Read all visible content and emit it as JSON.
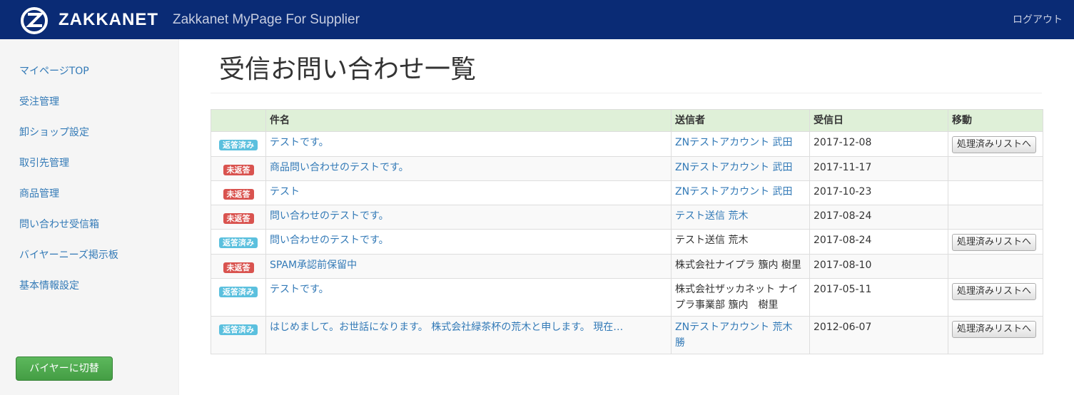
{
  "header": {
    "brand": "ZAKKANET",
    "subtitle": "Zakkanet MyPage For Supplier",
    "logout": "ログアウト"
  },
  "sidebar": {
    "items": [
      {
        "label": "マイページTOP"
      },
      {
        "label": "受注管理"
      },
      {
        "label": "卸ショップ設定"
      },
      {
        "label": "取引先管理"
      },
      {
        "label": "商品管理"
      },
      {
        "label": "問い合わせ受信箱"
      },
      {
        "label": "バイヤーニーズ掲示板"
      },
      {
        "label": "基本情報設定"
      }
    ],
    "switch_button": "バイヤーに切替"
  },
  "main": {
    "title": "受信お問い合わせ一覧",
    "table": {
      "columns": [
        "",
        "件名",
        "送信者",
        "受信日",
        "移動"
      ],
      "rows": [
        {
          "status": "返答済み",
          "status_type": "replied",
          "subject": "テストです。",
          "sender": "ZNテストアカウント 武田",
          "sender_link": true,
          "date": "2017-12-08",
          "action": "処理済みリストへ"
        },
        {
          "status": "未返答",
          "status_type": "unreplied",
          "subject": "商品問い合わせのテストです。",
          "sender": "ZNテストアカウント 武田",
          "sender_link": true,
          "date": "2017-11-17",
          "action": ""
        },
        {
          "status": "未返答",
          "status_type": "unreplied",
          "subject": "テスト",
          "sender": "ZNテストアカウント 武田",
          "sender_link": true,
          "date": "2017-10-23",
          "action": ""
        },
        {
          "status": "未返答",
          "status_type": "unreplied",
          "subject": "問い合わせのテストです。",
          "sender": "テスト送信 荒木",
          "sender_link": true,
          "date": "2017-08-24",
          "action": ""
        },
        {
          "status": "返答済み",
          "status_type": "replied",
          "subject": "問い合わせのテストです。",
          "sender": "テスト送信 荒木",
          "sender_link": false,
          "date": "2017-08-24",
          "action": "処理済みリストへ"
        },
        {
          "status": "未返答",
          "status_type": "unreplied",
          "subject": "SPAM承認前保留中",
          "sender": "株式会社ナイプラ 籏内 樹里",
          "sender_link": false,
          "date": "2017-08-10",
          "action": ""
        },
        {
          "status": "返答済み",
          "status_type": "replied",
          "subject": "テストです。",
          "sender": "株式会社ザッカネット ナイプラ事業部 籏内　樹里",
          "sender_link": false,
          "date": "2017-05-11",
          "action": "処理済みリストへ"
        },
        {
          "status": "返答済み",
          "status_type": "replied",
          "subject": "はじめまして。お世話になります。 株式会社緑茶杯の荒木と申します。 現在…",
          "sender": "ZNテストアカウント 荒木　勝",
          "sender_link": true,
          "date": "2012-06-07",
          "action": "処理済みリストへ"
        }
      ]
    }
  },
  "colors": {
    "navbar": "#0a2b75",
    "link": "#337ab7",
    "replied_badge": "#5bc0de",
    "unreplied_badge": "#d9534f",
    "header_row": "#dff0d8",
    "switch_button": "#5cb85c"
  },
  "icons": {
    "logo": "zakkanet-z-logo"
  }
}
